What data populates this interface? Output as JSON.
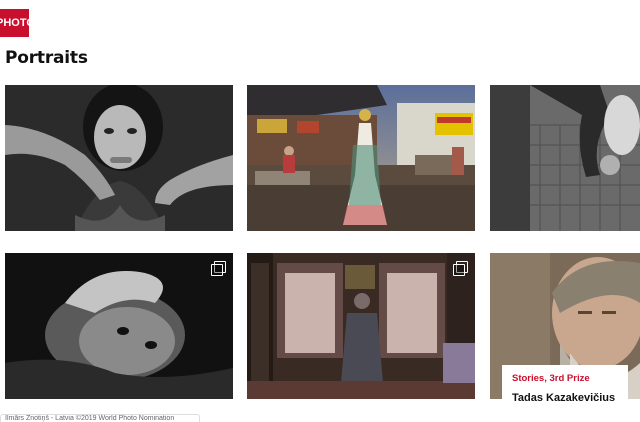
{
  "header": {
    "brand_label": "PHOTO",
    "section_title": "Portraits"
  },
  "tiles": [
    {
      "subject": "woman held by hands, black and white portrait",
      "multi_image": false
    },
    {
      "subject": "woman in embroidered gown at outdoor market",
      "multi_image": false
    },
    {
      "subject": "figure hanging upside down near fence",
      "multi_image": false
    },
    {
      "subject": "boy lying on side with hand on head",
      "multi_image": true
    },
    {
      "subject": "elderly woman facing window in room",
      "multi_image": true
    },
    {
      "subject": "bearded man with closed eyes",
      "multi_image": false
    }
  ],
  "featured_caption": {
    "category": "Stories, 3rd Prize",
    "author": "Tadas Kazakevičius"
  },
  "credit_text": "Ilmārs Znotiņš - Latvia ©2019 World Photo Nomination",
  "colors": {
    "accent": "#c8102e",
    "background": "#ffffff"
  },
  "icons": {
    "multi_image": "stacked-photos-icon"
  }
}
